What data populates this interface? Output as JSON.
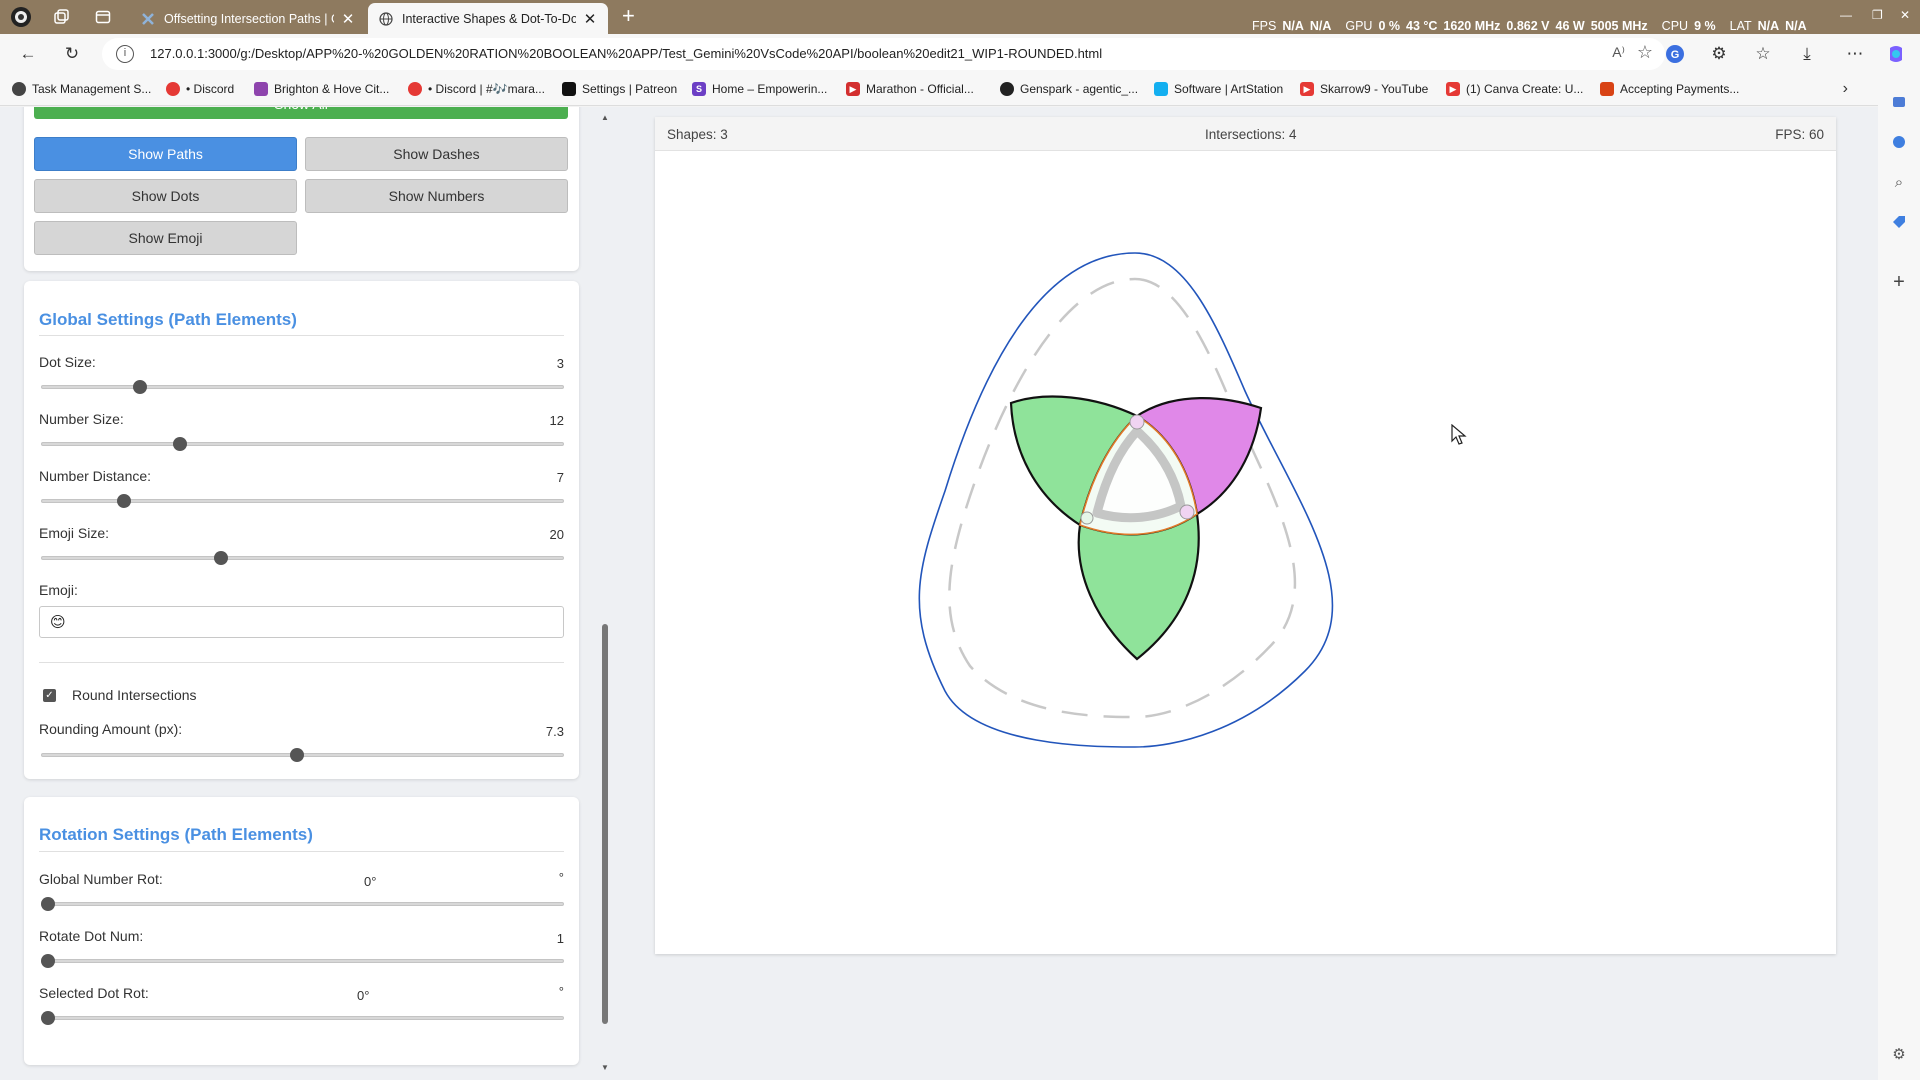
{
  "browser": {
    "tabs": [
      {
        "title": "Offsetting Intersection Paths | Go",
        "active": false
      },
      {
        "title": "Interactive Shapes & Dot-To-Dot",
        "active": true
      }
    ],
    "hud": {
      "fps_label": "FPS",
      "fps_val1": "N/A",
      "fps_val2": "N/A",
      "gpu_label": "GPU",
      "gpu_load": "0 %",
      "gpu_temp": "43 °C",
      "gpu_clock": "1620 MHz",
      "gpu_volt": "0.862 V",
      "gpu_power": "46 W",
      "gpu_mem": "5005 MHz",
      "cpu_label": "CPU",
      "cpu_load": "9 %",
      "lat_label": "LAT",
      "lat_val1": "N/A",
      "lat_val2": "N/A"
    },
    "url": "127.0.0.1:3000/g:/Desktop/APP%20-%20GOLDEN%20RATION%20BOOLEAN%20APP/Test_Gemini%20VsCode%20API/boolean%20edit21_WIP1-ROUNDED.html",
    "bookmarks": [
      {
        "label": "Task Management S...",
        "color": "#444444"
      },
      {
        "label": "• Discord",
        "color": "#e53935"
      },
      {
        "label": "Brighton & Hove Cit...",
        "color": "#8e44ad"
      },
      {
        "label": "• Discord | #🎶mara...",
        "color": "#e53935"
      },
      {
        "label": "Settings | Patreon",
        "color": "#111111"
      },
      {
        "label": "Home – Empowerin...",
        "color": "#6c3fc5"
      },
      {
        "label": "Marathon - Official...",
        "color": "#d32f2f"
      },
      {
        "label": "Genspark - agentic_...",
        "color": "#222222"
      },
      {
        "label": "Software | ArtStation",
        "color": "#13aff0"
      },
      {
        "label": "Skarrow9 - YouTube",
        "color": "#e53935"
      },
      {
        "label": "(1) Canva Create: U...",
        "color": "#e53935"
      },
      {
        "label": "Accepting Payments...",
        "color": "#d84315"
      }
    ]
  },
  "controls": {
    "show_all": "Show All",
    "show_paths": "Show Paths",
    "show_dashes": "Show Dashes",
    "show_dots": "Show Dots",
    "show_numbers": "Show Numbers",
    "show_emoji": "Show Emoji"
  },
  "global_settings": {
    "title": "Global Settings (Path Elements)",
    "dot_size": {
      "label": "Dot Size:",
      "value": "3",
      "fraction": 0.18
    },
    "number_size": {
      "label": "Number Size:",
      "value": "12",
      "fraction": 0.26
    },
    "number_distance": {
      "label": "Number Distance:",
      "value": "7",
      "fraction": 0.15
    },
    "emoji_size": {
      "label": "Emoji Size:",
      "value": "20",
      "fraction": 0.34
    },
    "emoji": {
      "label": "Emoji:",
      "value": "😊"
    },
    "round_intersections": {
      "label": "Round Intersections",
      "checked": true
    },
    "rounding_amount": {
      "label": "Rounding Amount (px):",
      "value": "7.3",
      "fraction": 0.49
    }
  },
  "rotation_settings": {
    "title": "Rotation Settings (Path Elements)",
    "global_number_rot": {
      "label": "Global Number Rot:",
      "value": "0°",
      "unit": "°",
      "fraction": 0
    },
    "rotate_dot_num": {
      "label": "Rotate Dot Num:",
      "value": "1",
      "fraction": 0
    },
    "selected_dot_rot": {
      "label": "Selected Dot Rot:",
      "value": "0°",
      "unit": "°",
      "fraction": 0
    }
  },
  "status": {
    "shapes": "Shapes: 3",
    "intersections": "Intersections: 4",
    "fps": "FPS: 60"
  },
  "colors": {
    "green_fill": "#8fe39a",
    "magenta_fill": "#e088e8",
    "outline_blue": "#2255bb",
    "accent_blue": "#4a90e2",
    "show_all_green": "#4caf50"
  }
}
